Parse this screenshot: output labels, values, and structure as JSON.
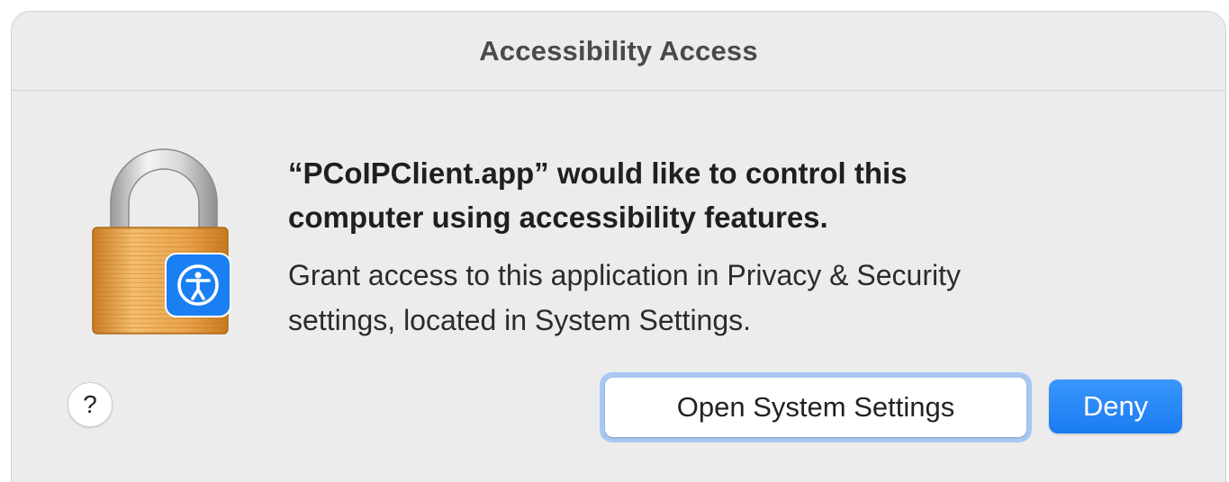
{
  "dialog": {
    "title": "Accessibility Access",
    "heading_lines": [
      "“PCoIPClient.app” would like to control this",
      "computer using accessibility features."
    ],
    "body_lines": [
      "Grant access to this application in Privacy & Security",
      "settings, located in System Settings."
    ],
    "icons": {
      "main": "lock-icon",
      "badge": "accessibility-icon"
    }
  },
  "buttons": {
    "help_label": "?",
    "open_settings_label": "Open System Settings",
    "deny_label": "Deny"
  },
  "colors": {
    "accent": "#1a7cf2",
    "focus_ring": "#a9c7f3",
    "lock_body": "#e8a54a"
  }
}
